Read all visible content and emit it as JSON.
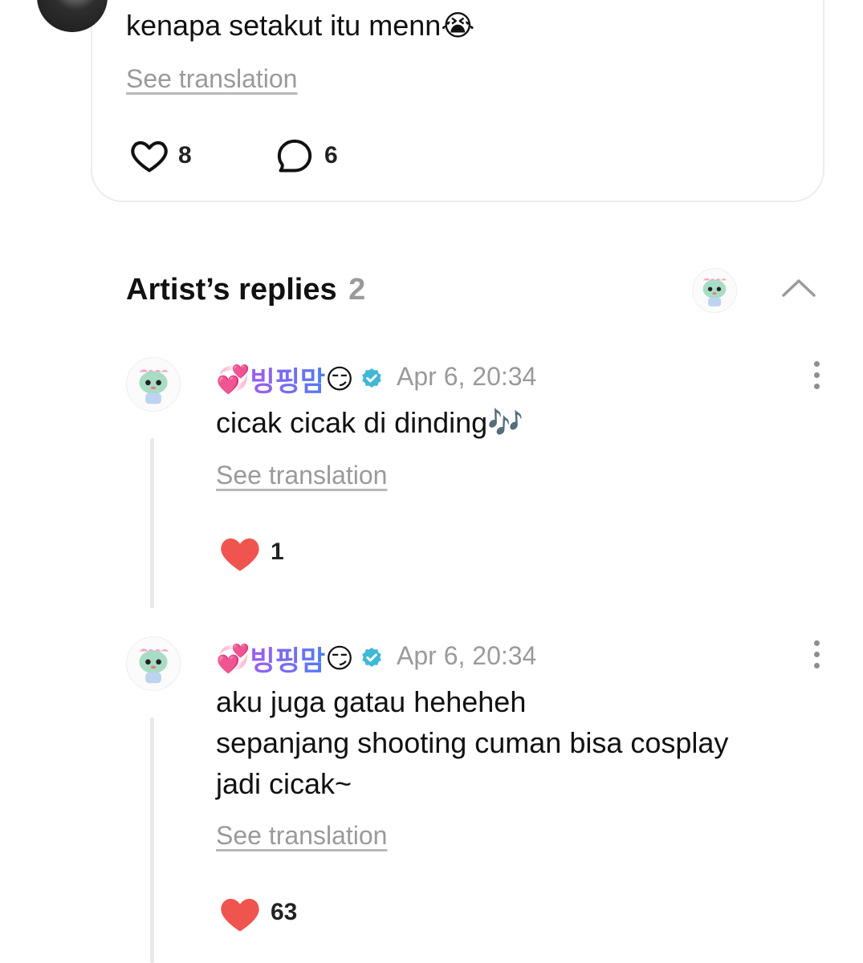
{
  "post": {
    "text": "kenapa setakut itu menn😭",
    "see_translation": "See translation",
    "likes": "8",
    "comments": "6",
    "icons": {
      "like": "heart-outline-icon",
      "comment": "comment-bubble-icon"
    }
  },
  "artist_replies": {
    "title": "Artist’s replies",
    "count": "2",
    "icons": {
      "collapse": "chevron-up-icon"
    }
  },
  "replies": [
    {
      "author_prefix": "💞",
      "author": "빙핑맘",
      "author_suffix": "😏",
      "date": "Apr 6, 20:34",
      "text_lines": [
        "cicak cicak di dinding🎶"
      ],
      "see_translation": "See translation",
      "likes": "1"
    },
    {
      "author_prefix": "💞",
      "author": "빙핑맘",
      "author_suffix": "😏",
      "date": "Apr 6, 20:34",
      "text_lines": [
        "aku juga gatau heheheh",
        "sepanjang shooting cuman bisa cosplay",
        "jadi cicak~"
      ],
      "see_translation": "See translation",
      "likes": "63"
    }
  ],
  "colors": {
    "heart_filled": "#f0544f",
    "verified_badge": "#40b8d6",
    "muted_text": "#9a9a9a",
    "name_gradient_start": "#a05cf0",
    "name_gradient_end": "#4f7cf5"
  }
}
